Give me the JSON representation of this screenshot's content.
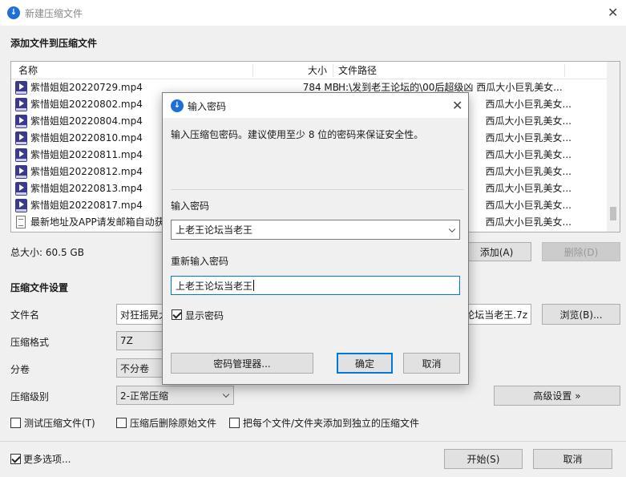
{
  "window": {
    "title": "新建压缩文件"
  },
  "section_add": {
    "title": "添加文件到压缩文件"
  },
  "file_list": {
    "headers": {
      "name": "名称",
      "size": "大小",
      "path": "文件路径"
    },
    "rows": [
      {
        "icon": "mp4-file-icon",
        "name": "紫惜姐姐20220729.mp4",
        "size": "784 MB",
        "path": "H:\\发到老王论坛的\\00后超级凶 西瓜大小巨乳美女..."
      },
      {
        "icon": "mp4-file-icon",
        "name": "紫惜姐姐20220802.mp4",
        "size": "",
        "path": "西瓜大小巨乳美女..."
      },
      {
        "icon": "mp4-file-icon",
        "name": "紫惜姐姐20220804.mp4",
        "size": "",
        "path": "西瓜大小巨乳美女..."
      },
      {
        "icon": "mp4-file-icon",
        "name": "紫惜姐姐20220810.mp4",
        "size": "",
        "path": "西瓜大小巨乳美女..."
      },
      {
        "icon": "mp4-file-icon",
        "name": "紫惜姐姐20220811.mp4",
        "size": "",
        "path": "西瓜大小巨乳美女..."
      },
      {
        "icon": "mp4-file-icon",
        "name": "紫惜姐姐20220812.mp4",
        "size": "",
        "path": "西瓜大小巨乳美女..."
      },
      {
        "icon": "mp4-file-icon",
        "name": "紫惜姐姐20220813.mp4",
        "size": "",
        "path": "西瓜大小巨乳美女..."
      },
      {
        "icon": "mp4-file-icon",
        "name": "紫惜姐姐20220817.mp4",
        "size": "",
        "path": "西瓜大小巨乳美女..."
      },
      {
        "icon": "text-file-icon",
        "name": "最新地址及APP请发邮箱自动获",
        "size": "",
        "path": "西瓜大小巨乳美女..."
      }
    ]
  },
  "total_size": "总大小: 60.5 GB",
  "buttons": {
    "add": "添加(A)",
    "delete": "删除(D)",
    "browse": "浏览(B)...",
    "advanced": "高级设置 »",
    "start": "开始(S)",
    "cancel": "取消"
  },
  "settings": {
    "title": "压缩文件设置",
    "filename_label": "文件名",
    "filename_value_left": "对狂摇晃大奶",
    "filename_value_right": "论坛当老王.7z",
    "format_label": "压缩格式",
    "format_value": "7Z",
    "split_label": "分卷",
    "split_value": "不分卷",
    "level_label": "压缩级别",
    "level_value": "2-正常压缩"
  },
  "options": {
    "test": "测试压缩文件(T)",
    "delete_after": "压缩后删除原始文件",
    "separate": "把每个文件/文件夹添加到独立的压缩文件",
    "more": "更多选项..."
  },
  "dialog": {
    "title": "输入密码",
    "description": "输入压缩包密码。建议使用至少 8 位的密码来保证安全性。",
    "password_label": "输入密码",
    "password_value": "上老王论坛当老王",
    "confirm_label": "重新输入密码",
    "confirm_value": "上老王论坛当老王",
    "show_password": "显示密码",
    "manager_button": "密码管理器...",
    "ok_button": "确定",
    "cancel_button": "取消"
  },
  "colors": {
    "accent": "#0078d7",
    "app_icon": "#1e6fd9"
  }
}
